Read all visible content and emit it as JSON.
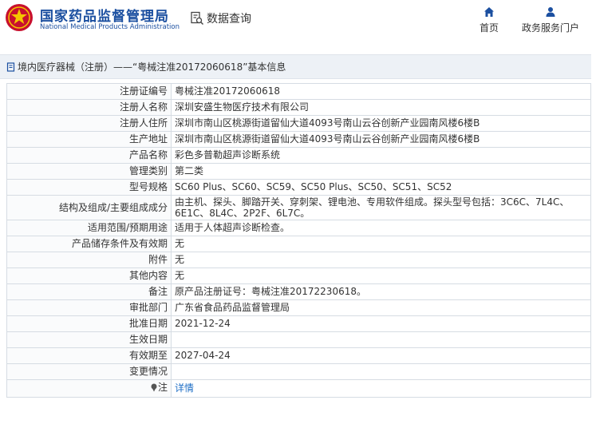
{
  "header": {
    "brand_cn": "国家药品监督管理局",
    "brand_en": "National Medical Products Administration",
    "query_label": "数据查询",
    "nav": [
      {
        "label": "首页",
        "icon": "home-icon"
      },
      {
        "label": "政务服务门户",
        "icon": "user-icon"
      }
    ]
  },
  "breadcrumb": {
    "text": "境内医疗器械（注册）——“粤械注准20172060618”基本信息"
  },
  "rows": [
    {
      "label": "注册证编号",
      "value": "粤械注准20172060618"
    },
    {
      "label": "注册人名称",
      "value": "深圳安盛生物医疗技术有限公司"
    },
    {
      "label": "注册人住所",
      "value": "深圳市南山区桃源街道留仙大道4093号南山云谷创新产业园南风楼6楼B"
    },
    {
      "label": "生产地址",
      "value": "深圳市南山区桃源街道留仙大道4093号南山云谷创新产业园南风楼6楼B"
    },
    {
      "label": "产品名称",
      "value": "彩色多普勒超声诊断系统"
    },
    {
      "label": "管理类别",
      "value": "第二类"
    },
    {
      "label": "型号规格",
      "value": "SC60 Plus、SC60、SC59、SC50 Plus、SC50、SC51、SC52"
    },
    {
      "label": "结构及组成/主要组成成分",
      "value": "由主机、探头、脚踏开关、穿刺架、锂电池、专用软件组成。探头型号包括：3C6C、7L4C、6E1C、8L4C、2P2F、6L7C。"
    },
    {
      "label": "适用范围/预期用途",
      "value": "适用于人体超声诊断检查。"
    },
    {
      "label": "产品储存条件及有效期",
      "value": "无"
    },
    {
      "label": "附件",
      "value": "无"
    },
    {
      "label": "其他内容",
      "value": "无"
    },
    {
      "label": "备注",
      "value": "原产品注册证号：粤械注准20172230618。"
    },
    {
      "label": "审批部门",
      "value": "广东省食品药品监督管理局"
    },
    {
      "label": "批准日期",
      "value": "2021-12-24"
    },
    {
      "label": "生效日期",
      "value": ""
    },
    {
      "label": "有效期至",
      "value": "2027-04-24"
    },
    {
      "label": "变更情况",
      "value": ""
    }
  ],
  "note_row": {
    "label": "注",
    "link": "详情"
  }
}
